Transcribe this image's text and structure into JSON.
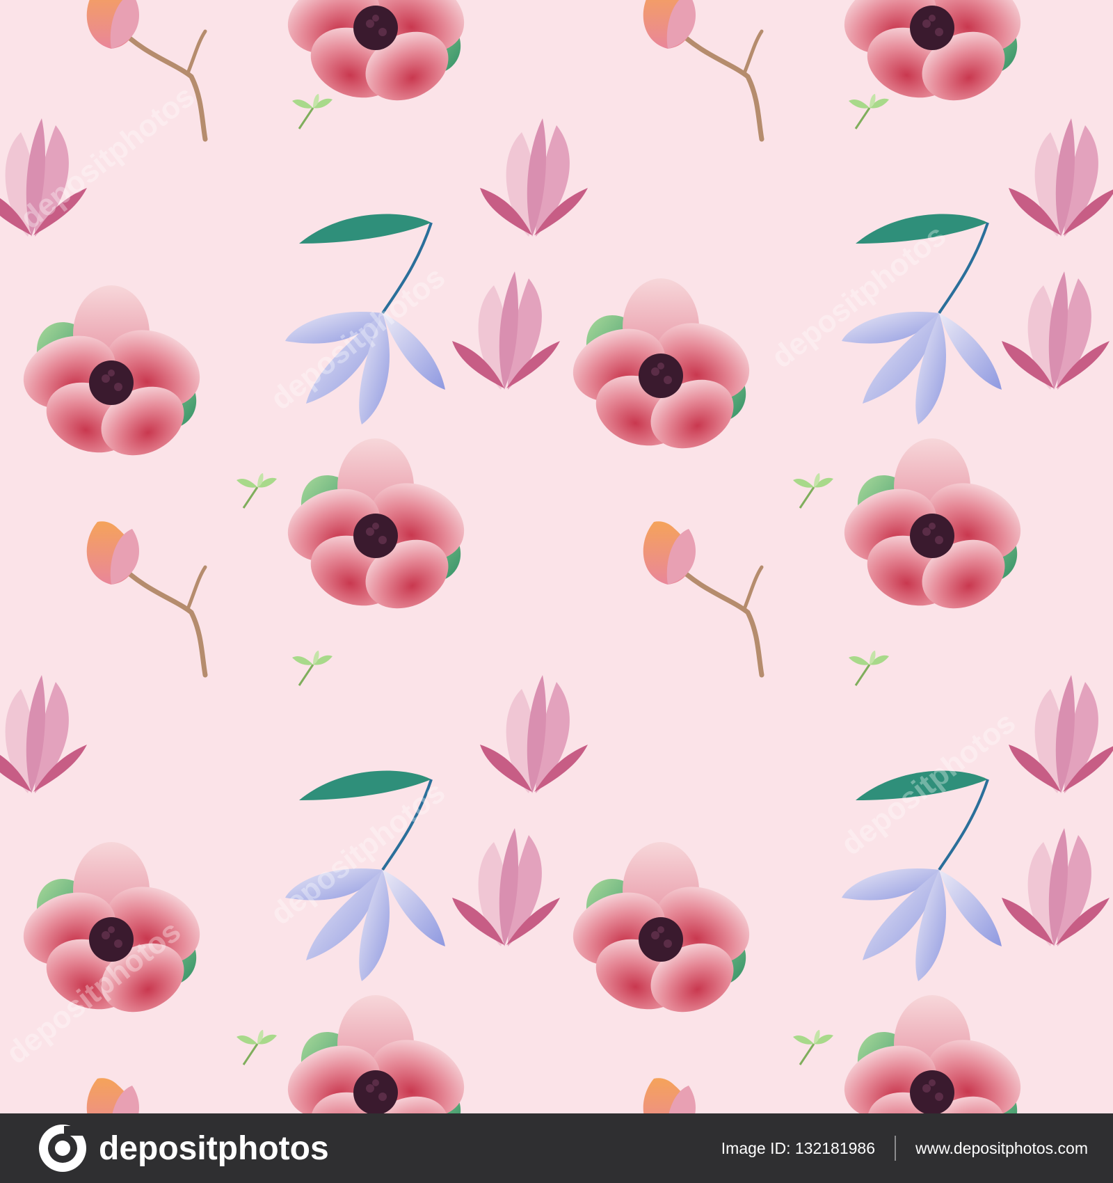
{
  "footer": {
    "brand": "depositphotos",
    "image_id_label": "Image ID: 132181986",
    "site_url": "www.depositphotos.com"
  },
  "watermark": {
    "text": "depositphotos"
  },
  "colors": {
    "background": "#fbe3e8",
    "footer_bg": "#2f2f31",
    "pink_petal": "#e68a98",
    "deep_pink": "#c9384f",
    "blue_petal": "#9ea8e6",
    "leaf_green": "#4aa86a",
    "flower_center": "#3a1a2e"
  },
  "icons": {
    "logo": "depositphotos-logo-icon"
  }
}
